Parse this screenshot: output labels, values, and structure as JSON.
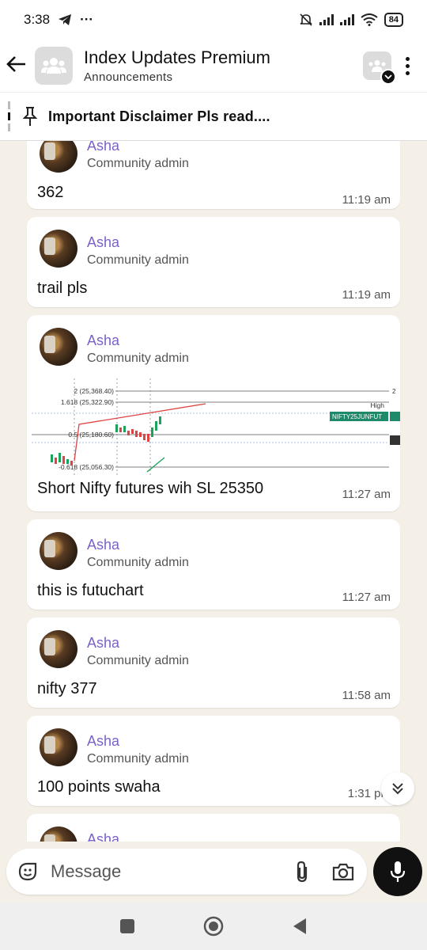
{
  "status_bar": {
    "time": "3:38",
    "extra": "···",
    "battery": "84"
  },
  "header": {
    "title": "Index Updates Premium",
    "subtitle": "Announcements"
  },
  "pinned": {
    "text": "Important Disclaimer Pls read...."
  },
  "messages": [
    {
      "sender": "Asha",
      "role": "Community admin",
      "text": "362",
      "time": "11:19 am"
    },
    {
      "sender": "Asha",
      "role": "Community admin",
      "text": "trail pls",
      "time": "11:19 am"
    },
    {
      "sender": "Asha",
      "role": "Community admin",
      "text": "Short Nifty futures wih SL 25350",
      "time": "11:27 am",
      "chart_labels": {
        "l2": "2 (25,368.40)",
        "l1618": "1.618 (25,322.90)",
        "l05": "0.5 (25,180.60)",
        "l0618": "-0.618 (25,056.30)",
        "high": "High",
        "ticker": "NIFTY25JUNFUT",
        "edge": "2"
      }
    },
    {
      "sender": "Asha",
      "role": "Community admin",
      "text": "this is futuchart",
      "time": "11:27 am"
    },
    {
      "sender": "Asha",
      "role": "Community admin",
      "text": "nifty 377",
      "time": "11:58 am"
    },
    {
      "sender": "Asha",
      "role": "Community admin",
      "text": "100 points swaha",
      "time": "1:31 pm"
    },
    {
      "sender": "Asha"
    }
  ],
  "composer": {
    "placeholder": "Message"
  },
  "colors": {
    "sender": "#7b61c9",
    "background": "#f4efe7",
    "mic_button": "#111111"
  },
  "icons": {
    "back": "arrow-left-icon",
    "group": "group-icon",
    "community": "community-icon",
    "menu": "kebab-icon",
    "pin": "pin-icon",
    "emoji": "sticker-icon",
    "attach": "paperclip-icon",
    "camera": "camera-icon",
    "mic": "mic-icon",
    "scroll": "double-chevron-down-icon"
  }
}
